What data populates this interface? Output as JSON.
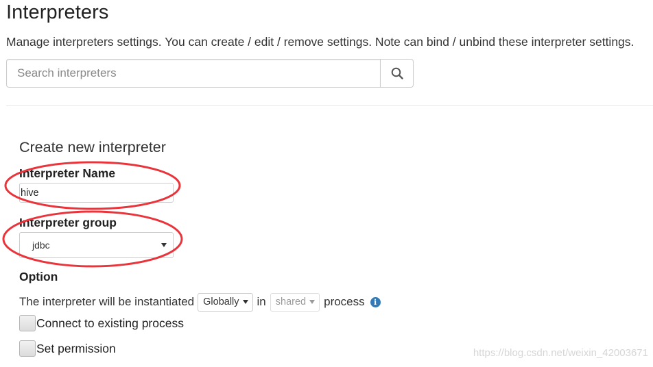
{
  "page": {
    "title": "Interpreters",
    "description": "Manage interpreters settings. You can create / edit / remove settings. Note can bind / unbind these interpreter settings."
  },
  "search": {
    "placeholder": "Search interpreters",
    "value": "",
    "button_icon": "search-icon"
  },
  "create_form": {
    "title": "Create new interpreter",
    "name_label": "Interpreter Name",
    "name_value": "hive",
    "group_label": "Interpreter group",
    "group_value": "jdbc",
    "option_label": "Option",
    "option_text_before": "The interpreter will be instantiated",
    "instantiation_value": "Globally",
    "in_text": "in",
    "process_mode_value": "shared",
    "process_text": "process",
    "info_icon": "info-circle-icon",
    "connect_existing_label": "Connect to existing process",
    "connect_existing_checked": false,
    "set_permission_label": "Set permission",
    "set_permission_checked": false
  },
  "annotations": {
    "highlight_color": "#e8343a"
  },
  "watermark": "https://blog.csdn.net/weixin_42003671",
  "colors": {
    "info": "#337ab7",
    "border": "#cccccc"
  }
}
